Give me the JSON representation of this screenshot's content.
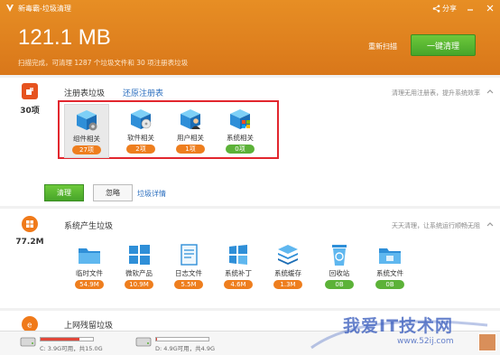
{
  "window": {
    "title": "新毒霸-垃圾清理",
    "share_label": "分享"
  },
  "summary": {
    "size": "121.1 MB",
    "text": "扫描完成，可清理 1287 个垃圾文件和 30 项注册表垃圾",
    "rescan": "重新扫描",
    "clean_all": "一键清理"
  },
  "registry": {
    "count": "30项",
    "tab_active": "注册表垃圾",
    "tab_restore": "还原注册表",
    "hint": "清理无用注册表，提升系统效率",
    "items": [
      {
        "label": "组件相关",
        "badge": "27项",
        "badge_color": "orange",
        "selected": true
      },
      {
        "label": "软件相关",
        "badge": "2项",
        "badge_color": "orange"
      },
      {
        "label": "用户相关",
        "badge": "1项",
        "badge_color": "orange"
      },
      {
        "label": "系统相关",
        "badge": "0项",
        "badge_color": "green"
      }
    ],
    "clean_btn": "清理",
    "ignore_btn": "忽略",
    "detail_link": "垃圾详情"
  },
  "system": {
    "count": "77.2M",
    "title": "系统产生垃圾",
    "hint": "天天清理，让系统运行顺畅无阻",
    "items": [
      {
        "label": "临时文件",
        "badge": "54.9M",
        "icon": "folder-icon"
      },
      {
        "label": "微软产品",
        "badge": "10.9M",
        "icon": "windows-icon"
      },
      {
        "label": "日志文件",
        "badge": "5.5M",
        "icon": "log-file-icon"
      },
      {
        "label": "系统补丁",
        "badge": "4.6M",
        "icon": "patch-icon"
      },
      {
        "label": "系统缓存",
        "badge": "1.3M",
        "icon": "cache-stack-icon"
      },
      {
        "label": "回收站",
        "badge": "0B",
        "icon": "recycle-bin-icon"
      },
      {
        "label": "系统文件",
        "badge": "0B",
        "icon": "system-folder-icon"
      }
    ]
  },
  "browser": {
    "title": "上网残留垃圾"
  },
  "drives": [
    {
      "label": "C: 3.9G可用，共15.0G",
      "used_fraction": 0.74
    },
    {
      "label": "D: 4.9G可用，共4.9G",
      "used_fraction": 0.02
    }
  ],
  "watermark": {
    "text": "我爱IT技术网",
    "url": "www.52ij.com"
  },
  "colors": {
    "header": "#e08420",
    "accent_green": "#4fae2f",
    "badge_orange": "#ee7e1e",
    "highlight_red": "#e2262e"
  }
}
